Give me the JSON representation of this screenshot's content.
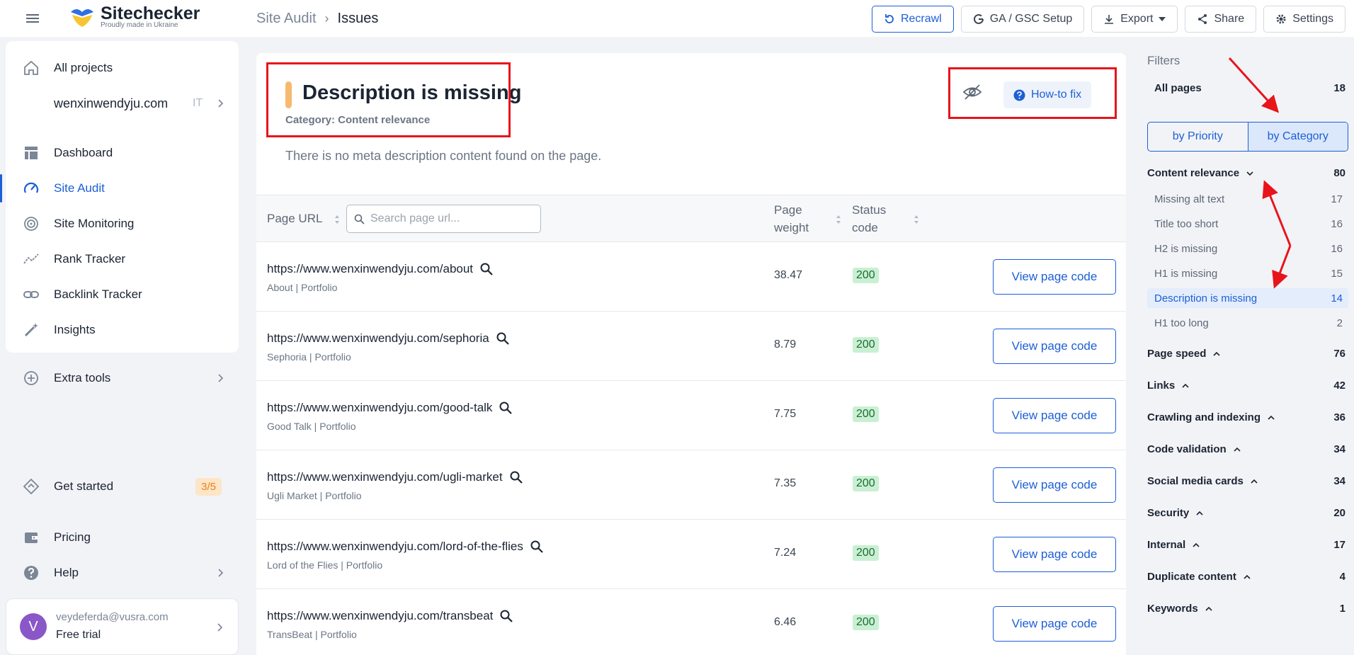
{
  "topbar": {
    "logo": {
      "name": "Sitechecker",
      "tagline": "Proudly made in Ukraine"
    },
    "breadcrumb": {
      "parent": "Site Audit",
      "separator": "›",
      "current": "Issues"
    },
    "actions": {
      "recrawl": "Recrawl",
      "ga_gsc": "GA / GSC Setup",
      "export": "Export",
      "share": "Share",
      "settings": "Settings"
    }
  },
  "sidebar": {
    "all_projects": "All projects",
    "project": {
      "name": "wenxinwendyju.com",
      "lang": "IT"
    },
    "nav": [
      {
        "label": "Dashboard",
        "icon": "dashboard-icon"
      },
      {
        "label": "Site Audit",
        "icon": "gauge-icon"
      },
      {
        "label": "Site Monitoring",
        "icon": "monitoring-icon"
      },
      {
        "label": "Rank Tracker",
        "icon": "trend-icon"
      },
      {
        "label": "Backlink Tracker",
        "icon": "link-icon"
      },
      {
        "label": "Insights",
        "icon": "magic-wand-icon"
      }
    ],
    "extra_tools": "Extra tools",
    "get_started": {
      "label": "Get started",
      "progress": "3/5"
    },
    "pricing": "Pricing",
    "help": "Help",
    "user": {
      "initial": "V",
      "email": "veydeferda@vusra.com",
      "plan": "Free trial"
    }
  },
  "issue": {
    "title": "Description is missing",
    "category": "Category: Content relevance",
    "description": "There is no meta description content found on the page.",
    "how_to_fix": "How-to fix"
  },
  "table": {
    "headers": {
      "url": "Page URL",
      "weight_1": "Page",
      "weight_2": "weight",
      "status_1": "Status",
      "status_2": "code"
    },
    "search_placeholder": "Search page url...",
    "view_label": "View page code",
    "rows": [
      {
        "url": "https://www.wenxinwendyju.com/about",
        "title": "About | Portfolio",
        "weight": "38.47",
        "status": "200"
      },
      {
        "url": "https://www.wenxinwendyju.com/sephoria",
        "title": "Sephoria | Portfolio",
        "weight": "8.79",
        "status": "200"
      },
      {
        "url": "https://www.wenxinwendyju.com/good-talk",
        "title": "Good Talk | Portfolio",
        "weight": "7.75",
        "status": "200"
      },
      {
        "url": "https://www.wenxinwendyju.com/ugli-market",
        "title": "Ugli Market | Portfolio",
        "weight": "7.35",
        "status": "200"
      },
      {
        "url": "https://www.wenxinwendyju.com/lord-of-the-flies",
        "title": "Lord of the Flies | Portfolio",
        "weight": "7.24",
        "status": "200"
      },
      {
        "url": "https://www.wenxinwendyju.com/transbeat",
        "title": "TransBeat | Portfolio",
        "weight": "6.46",
        "status": "200"
      }
    ]
  },
  "filters": {
    "title": "Filters",
    "all_pages": {
      "name": "All pages",
      "count": "18"
    },
    "toggle": {
      "priority": "by Priority",
      "category": "by Category"
    },
    "content_relevance": {
      "name": "Content relevance",
      "count": "80"
    },
    "sub_items": [
      {
        "name": "Missing alt text",
        "count": "17"
      },
      {
        "name": "Title too short",
        "count": "16"
      },
      {
        "name": "H2 is missing",
        "count": "16"
      },
      {
        "name": "H1 is missing",
        "count": "15"
      },
      {
        "name": "Description is missing",
        "count": "14"
      },
      {
        "name": "H1 too long",
        "count": "2"
      }
    ],
    "groups": [
      {
        "name": "Page speed",
        "count": "76"
      },
      {
        "name": "Links",
        "count": "42"
      },
      {
        "name": "Crawling and indexing",
        "count": "36"
      },
      {
        "name": "Code validation",
        "count": "34"
      },
      {
        "name": "Social media cards",
        "count": "34"
      },
      {
        "name": "Security",
        "count": "20"
      },
      {
        "name": "Internal",
        "count": "17"
      },
      {
        "name": "Duplicate content",
        "count": "4"
      },
      {
        "name": "Keywords",
        "count": "1"
      }
    ]
  },
  "colors": {
    "accent": "#1c5fd6",
    "annotation": "#e8141b",
    "status_ok_bg": "#c9f0d3",
    "marker": "#f7b970"
  }
}
